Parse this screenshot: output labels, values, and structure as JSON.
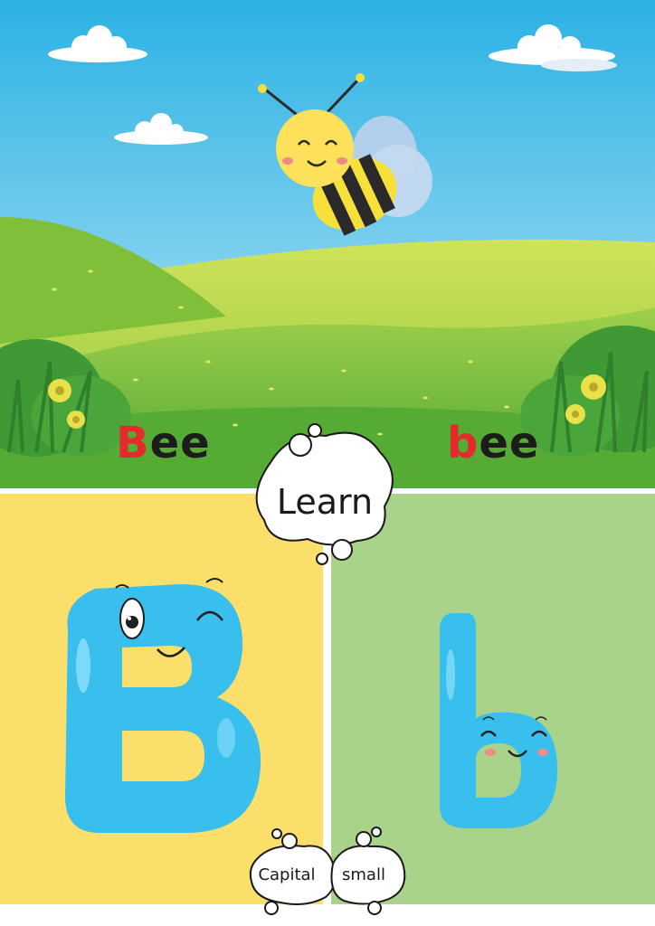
{
  "word_capital": {
    "first_letter": "B",
    "rest": "ee"
  },
  "word_small": {
    "first_letter": "b",
    "rest": "ee"
  },
  "learn_label": "Learn",
  "capital_label": "Capital",
  "small_label": "small",
  "colors": {
    "sky_top": "#2bb2e4",
    "sky_bottom": "#bfe6f4",
    "grass": "#5fb13a",
    "letter_highlight": "#e32b2b",
    "capital_panel": "#fbdf6b",
    "small_panel": "#a9d28a",
    "letter_blue": "#38bfee"
  },
  "icons": [
    "bee-icon",
    "cloud-icon",
    "flower-icon",
    "bush-icon",
    "letter-B-icon",
    "letter-b-icon",
    "thought-bubble-icon"
  ]
}
